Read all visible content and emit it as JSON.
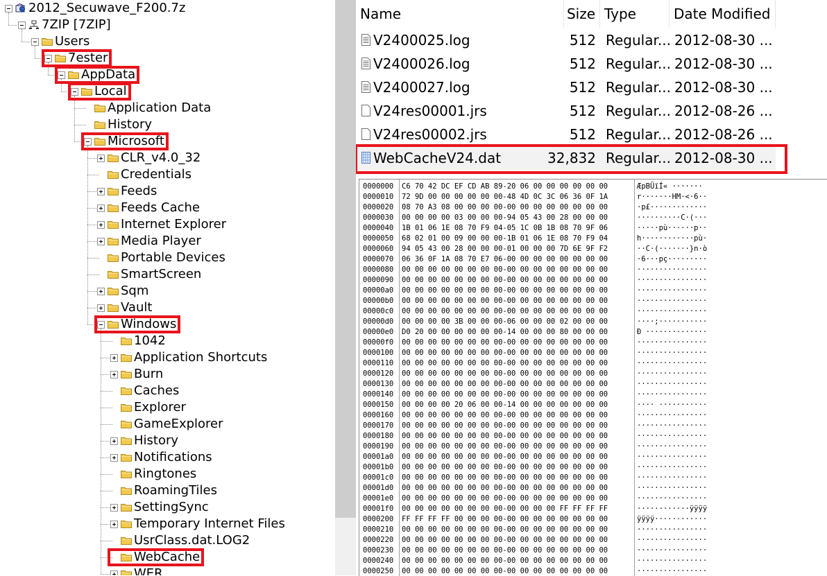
{
  "tree": {
    "items": [
      {
        "label": "2012_Secuwave_F200.7z",
        "icon": "archive-icon",
        "level": 0,
        "expander": "minus"
      },
      {
        "label": "7ZIP [7ZIP]",
        "icon": "network-icon",
        "level": 1,
        "expander": "minus"
      },
      {
        "label": "Users",
        "icon": "folder-icon",
        "level": 2,
        "expander": "minus"
      },
      {
        "label": "7ester",
        "icon": "folder-icon",
        "level": 3,
        "expander": "minus",
        "highlight": true
      },
      {
        "label": "AppData",
        "icon": "folder-icon",
        "level": 4,
        "expander": "minus",
        "highlight": true
      },
      {
        "label": "Local",
        "icon": "folder-icon",
        "level": 5,
        "expander": "minus",
        "highlight": true
      },
      {
        "label": "Application Data",
        "icon": "folder-icon",
        "level": 6,
        "expander": "none"
      },
      {
        "label": "History",
        "icon": "folder-icon",
        "level": 6,
        "expander": "none"
      },
      {
        "label": "Microsoft",
        "icon": "folder-icon",
        "level": 6,
        "expander": "minus",
        "highlight": true
      },
      {
        "label": "CLR_v4.0_32",
        "icon": "folder-icon",
        "level": 7,
        "expander": "plus"
      },
      {
        "label": "Credentials",
        "icon": "folder-icon",
        "level": 7,
        "expander": "none"
      },
      {
        "label": "Feeds",
        "icon": "folder-icon",
        "level": 7,
        "expander": "plus"
      },
      {
        "label": "Feeds Cache",
        "icon": "folder-icon",
        "level": 7,
        "expander": "plus"
      },
      {
        "label": "Internet Explorer",
        "icon": "folder-icon",
        "level": 7,
        "expander": "plus"
      },
      {
        "label": "Media Player",
        "icon": "folder-icon",
        "level": 7,
        "expander": "plus"
      },
      {
        "label": "Portable Devices",
        "icon": "folder-icon",
        "level": 7,
        "expander": "none"
      },
      {
        "label": "SmartScreen",
        "icon": "folder-icon",
        "level": 7,
        "expander": "none"
      },
      {
        "label": "Sqm",
        "icon": "folder-icon",
        "level": 7,
        "expander": "plus"
      },
      {
        "label": "Vault",
        "icon": "folder-icon",
        "level": 7,
        "expander": "plus"
      },
      {
        "label": "Windows",
        "icon": "folder-icon",
        "level": 7,
        "expander": "minus",
        "highlight": true
      },
      {
        "label": "1042",
        "icon": "folder-icon",
        "level": 8,
        "expander": "none"
      },
      {
        "label": "Application Shortcuts",
        "icon": "folder-icon",
        "level": 8,
        "expander": "plus"
      },
      {
        "label": "Burn",
        "icon": "folder-icon",
        "level": 8,
        "expander": "plus"
      },
      {
        "label": "Caches",
        "icon": "folder-icon",
        "level": 8,
        "expander": "none"
      },
      {
        "label": "Explorer",
        "icon": "folder-icon",
        "level": 8,
        "expander": "none"
      },
      {
        "label": "GameExplorer",
        "icon": "folder-icon",
        "level": 8,
        "expander": "none"
      },
      {
        "label": "History",
        "icon": "folder-icon",
        "level": 8,
        "expander": "plus"
      },
      {
        "label": "Notifications",
        "icon": "folder-icon",
        "level": 8,
        "expander": "plus"
      },
      {
        "label": "Ringtones",
        "icon": "folder-icon",
        "level": 8,
        "expander": "none"
      },
      {
        "label": "RoamingTiles",
        "icon": "folder-icon",
        "level": 8,
        "expander": "none"
      },
      {
        "label": "SettingSync",
        "icon": "folder-icon",
        "level": 8,
        "expander": "plus"
      },
      {
        "label": "Temporary Internet Files",
        "icon": "folder-icon",
        "level": 8,
        "expander": "plus"
      },
      {
        "label": "UsrClass.dat.LOG2",
        "icon": "folder-icon",
        "level": 8,
        "expander": "none"
      },
      {
        "label": "WebCache",
        "icon": "folder-icon",
        "level": 8,
        "expander": "none",
        "highlight": true
      },
      {
        "label": "WER",
        "icon": "folder-icon",
        "level": 8,
        "expander": "plus"
      }
    ]
  },
  "file_list": {
    "headers": {
      "name": "Name",
      "size": "Size",
      "type": "Type",
      "date": "Date Modified"
    },
    "rows": [
      {
        "name": "V2400025.log",
        "size": "512",
        "type": "Regular...",
        "date": "2012-08-30 ...",
        "icon": "text-file-icon"
      },
      {
        "name": "V2400026.log",
        "size": "512",
        "type": "Regular...",
        "date": "2012-08-30 ...",
        "icon": "text-file-icon"
      },
      {
        "name": "V2400027.log",
        "size": "512",
        "type": "Regular...",
        "date": "2012-08-30 ...",
        "icon": "text-file-icon"
      },
      {
        "name": "V24res00001.jrs",
        "size": "512",
        "type": "Regular...",
        "date": "2012-08-26 ...",
        "icon": "blank-file-icon"
      },
      {
        "name": "V24res00002.jrs",
        "size": "512",
        "type": "Regular...",
        "date": "2012-08-26 ...",
        "icon": "blank-file-icon"
      },
      {
        "name": "WebCacheV24.dat",
        "size": "32,832",
        "type": "Regular...",
        "date": "2012-08-30 ...",
        "icon": "data-file-icon",
        "selected": true,
        "highlight": true
      }
    ]
  },
  "hex_view": {
    "rows": [
      {
        "offset": "0000000",
        "bytes": "C6 70 42 DC EF CD AB 89-20 06 00 00 00 00 00 00",
        "ascii": "ÆpBÜïÍ« ·······"
      },
      {
        "offset": "0000010",
        "bytes": "72 9D 00 00 00 00 00 00-48 4D 0C 3C 06 36 0F 1A",
        "ascii": "r·······HM·<·6··"
      },
      {
        "offset": "0000020",
        "bytes": "08 70 A3 08 00 00 00 00-00 00 00 00 00 00 00 00",
        "ascii": "·p£·············"
      },
      {
        "offset": "0000030",
        "bytes": "00 00 00 00 03 00 00 00-94 05 43 00 28 00 00 00",
        "ascii": "··········C·(···"
      },
      {
        "offset": "0000040",
        "bytes": "1B 01 06 1E 08 70 F9 04-05 1C 0B 1B 08 70 9F 06",
        "ascii": "·····pù······p··"
      },
      {
        "offset": "0000050",
        "bytes": "68 02 01 00 09 00 00 00-1B 01 06 1E 08 70 F9 04",
        "ascii": "h············pù·"
      },
      {
        "offset": "0000060",
        "bytes": "94 05 43 00 28 00 00 00-01 00 00 00 7D 6E 9F F2",
        "ascii": "··C·(·······}n·ò"
      },
      {
        "offset": "0000070",
        "bytes": "06 36 0F 1A 08 70 E7 06-00 00 00 00 00 00 00 00",
        "ascii": "·6···pç·········"
      },
      {
        "offset": "0000080",
        "bytes": "00 00 00 00 00 00 00 00-00 00 00 00 00 00 00 00",
        "ascii": "················"
      },
      {
        "offset": "0000090",
        "bytes": "00 00 00 00 00 00 00 00-00 00 00 00 00 00 00 00",
        "ascii": "················"
      },
      {
        "offset": "00000a0",
        "bytes": "00 00 00 00 00 00 00 00-00 00 00 00 00 00 00 00",
        "ascii": "················"
      },
      {
        "offset": "00000b0",
        "bytes": "00 00 00 00 00 00 00 00-00 00 00 00 00 00 00 00",
        "ascii": "················"
      },
      {
        "offset": "00000c0",
        "bytes": "00 00 00 00 00 00 00 00-00 00 00 00 00 00 00 00",
        "ascii": "················"
      },
      {
        "offset": "00000d0",
        "bytes": "00 00 00 00 3B 00 00 00-06 00 00 00 02 00 00 00",
        "ascii": "····;···········"
      },
      {
        "offset": "00000e0",
        "bytes": "D0 20 00 00 00 00 00 00-14 00 00 00 80 00 00 00",
        "ascii": "Ð ··············"
      },
      {
        "offset": "00000f0",
        "bytes": "00 00 00 00 00 00 00 00-00 00 00 00 00 00 00 00",
        "ascii": "················"
      },
      {
        "offset": "0000100",
        "bytes": "00 00 00 00 00 00 00 00-00 00 00 00 00 00 00 00",
        "ascii": "················"
      },
      {
        "offset": "0000110",
        "bytes": "00 00 00 00 00 00 00 00-00 00 00 00 00 00 00 00",
        "ascii": "················"
      },
      {
        "offset": "0000120",
        "bytes": "00 00 00 00 00 00 00 00-00 00 00 00 00 00 00 00",
        "ascii": "················"
      },
      {
        "offset": "0000130",
        "bytes": "00 00 00 00 00 00 00 00-00 00 00 00 00 00 00 00",
        "ascii": "················"
      },
      {
        "offset": "0000140",
        "bytes": "00 00 00 00 00 00 00 00-00 00 00 00 00 00 00 00",
        "ascii": "················"
      },
      {
        "offset": "0000150",
        "bytes": "00 00 00 00 20 06 00 00-14 00 00 00 00 00 00 00",
        "ascii": "···· ···········"
      },
      {
        "offset": "0000160",
        "bytes": "00 00 00 00 00 00 00 00-00 00 00 00 00 00 00 00",
        "ascii": "················"
      },
      {
        "offset": "0000170",
        "bytes": "00 00 00 00 00 00 00 00-00 00 00 00 00 00 00 00",
        "ascii": "················"
      },
      {
        "offset": "0000180",
        "bytes": "00 00 00 00 00 00 00 00-00 00 00 00 00 00 00 00",
        "ascii": "················"
      },
      {
        "offset": "0000190",
        "bytes": "00 00 00 00 00 00 00 00-00 00 00 00 00 00 00 00",
        "ascii": "················"
      },
      {
        "offset": "00001a0",
        "bytes": "00 00 00 00 00 00 00 00-00 00 00 00 00 00 00 00",
        "ascii": "················"
      },
      {
        "offset": "00001b0",
        "bytes": "00 00 00 00 00 00 00 00-00 00 00 00 00 00 00 00",
        "ascii": "················"
      },
      {
        "offset": "00001c0",
        "bytes": "00 00 00 00 00 00 00 00-00 00 00 00 00 00 00 00",
        "ascii": "················"
      },
      {
        "offset": "00001d0",
        "bytes": "00 00 00 00 00 00 00 00-00 00 00 00 00 00 00 00",
        "ascii": "················"
      },
      {
        "offset": "00001e0",
        "bytes": "00 00 00 00 00 00 00 00-00 00 00 00 00 00 00 00",
        "ascii": "················"
      },
      {
        "offset": "00001f0",
        "bytes": "00 00 00 00 00 00 00 00-00 00 00 00 FF FF FF FF",
        "ascii": "············ÿÿÿÿ"
      },
      {
        "offset": "0000200",
        "bytes": "FF FF FF FF 00 00 00 00-00 00 00 00 00 00 00 00",
        "ascii": "ÿÿÿÿ············"
      },
      {
        "offset": "0000210",
        "bytes": "00 00 00 00 00 00 00 00-00 00 00 00 00 00 00 00",
        "ascii": "················"
      },
      {
        "offset": "0000220",
        "bytes": "00 00 00 00 00 00 00 00-00 00 00 00 00 00 00 00",
        "ascii": "················"
      },
      {
        "offset": "0000230",
        "bytes": "00 00 00 00 00 00 00 00-00 00 00 00 00 00 00 00",
        "ascii": "················"
      },
      {
        "offset": "0000240",
        "bytes": "00 00 00 00 00 00 00 00-00 00 00 00 00 00 00 00",
        "ascii": "················"
      },
      {
        "offset": "0000250",
        "bytes": "00 00 00 00 00 00 00 00-00 00 00 00 00 00 00 00",
        "ascii": "················"
      }
    ]
  },
  "colors": {
    "highlight": "#e8141c",
    "folder": "#f2c94c",
    "selected_row": "#f2f2f2"
  }
}
